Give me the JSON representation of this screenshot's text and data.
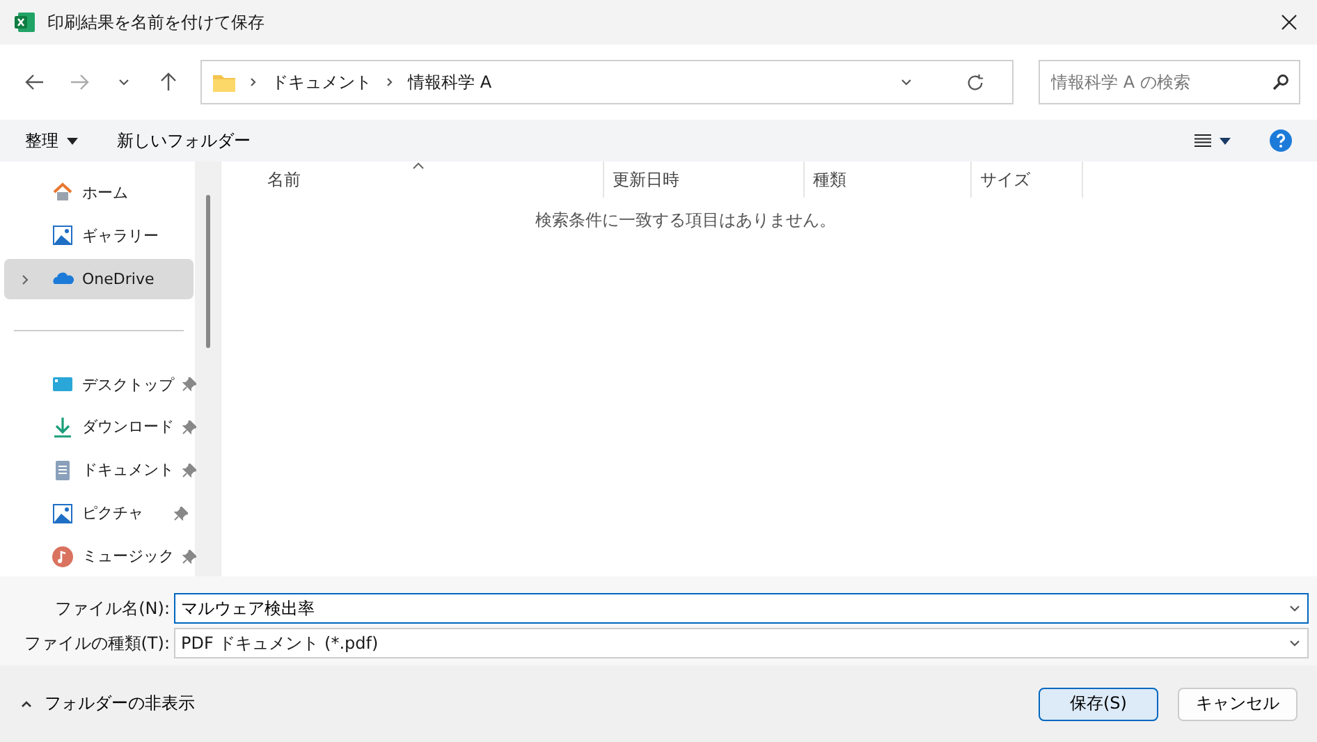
{
  "window": {
    "title": "印刷結果を名前を付けて保存"
  },
  "breadcrumb": [
    "ドキュメント",
    "情報科学 A"
  ],
  "search": {
    "placeholder": "情報科学 A の検索"
  },
  "toolbar": {
    "organize": "整理",
    "new_folder": "新しいフォルダー"
  },
  "sidebar": {
    "items": [
      {
        "label": "ホーム",
        "kind": "nav",
        "selected": false
      },
      {
        "label": "ギャラリー",
        "kind": "nav",
        "selected": false
      },
      {
        "label": "OneDrive",
        "kind": "expandable",
        "selected": true,
        "expanded": false
      },
      {
        "label": "デスクトップ",
        "kind": "pinned",
        "selected": false
      },
      {
        "label": "ダウンロード",
        "kind": "pinned",
        "selected": false
      },
      {
        "label": "ドキュメント",
        "kind": "pinned",
        "selected": false
      },
      {
        "label": "ピクチャ",
        "kind": "pinned",
        "selected": false
      },
      {
        "label": "ミュージック",
        "kind": "pinned",
        "selected": false
      }
    ]
  },
  "table": {
    "columns": [
      {
        "label": "名前",
        "sorted": true
      },
      {
        "label": "更新日時",
        "sorted": false
      },
      {
        "label": "種類",
        "sorted": false
      },
      {
        "label": "サイズ",
        "sorted": false
      }
    ],
    "empty_message": "検索条件に一致する項目はありません。"
  },
  "form": {
    "file_name_label": "ファイル名(N):",
    "file_name": "マルウェア検出率",
    "file_type_label": "ファイルの種類(T):",
    "file_type": "PDF ドキュメント (*.pdf)"
  },
  "footer": {
    "hide_folders": "フォルダーの非表示",
    "save": "保存(S)",
    "cancel": "キャンセル"
  }
}
